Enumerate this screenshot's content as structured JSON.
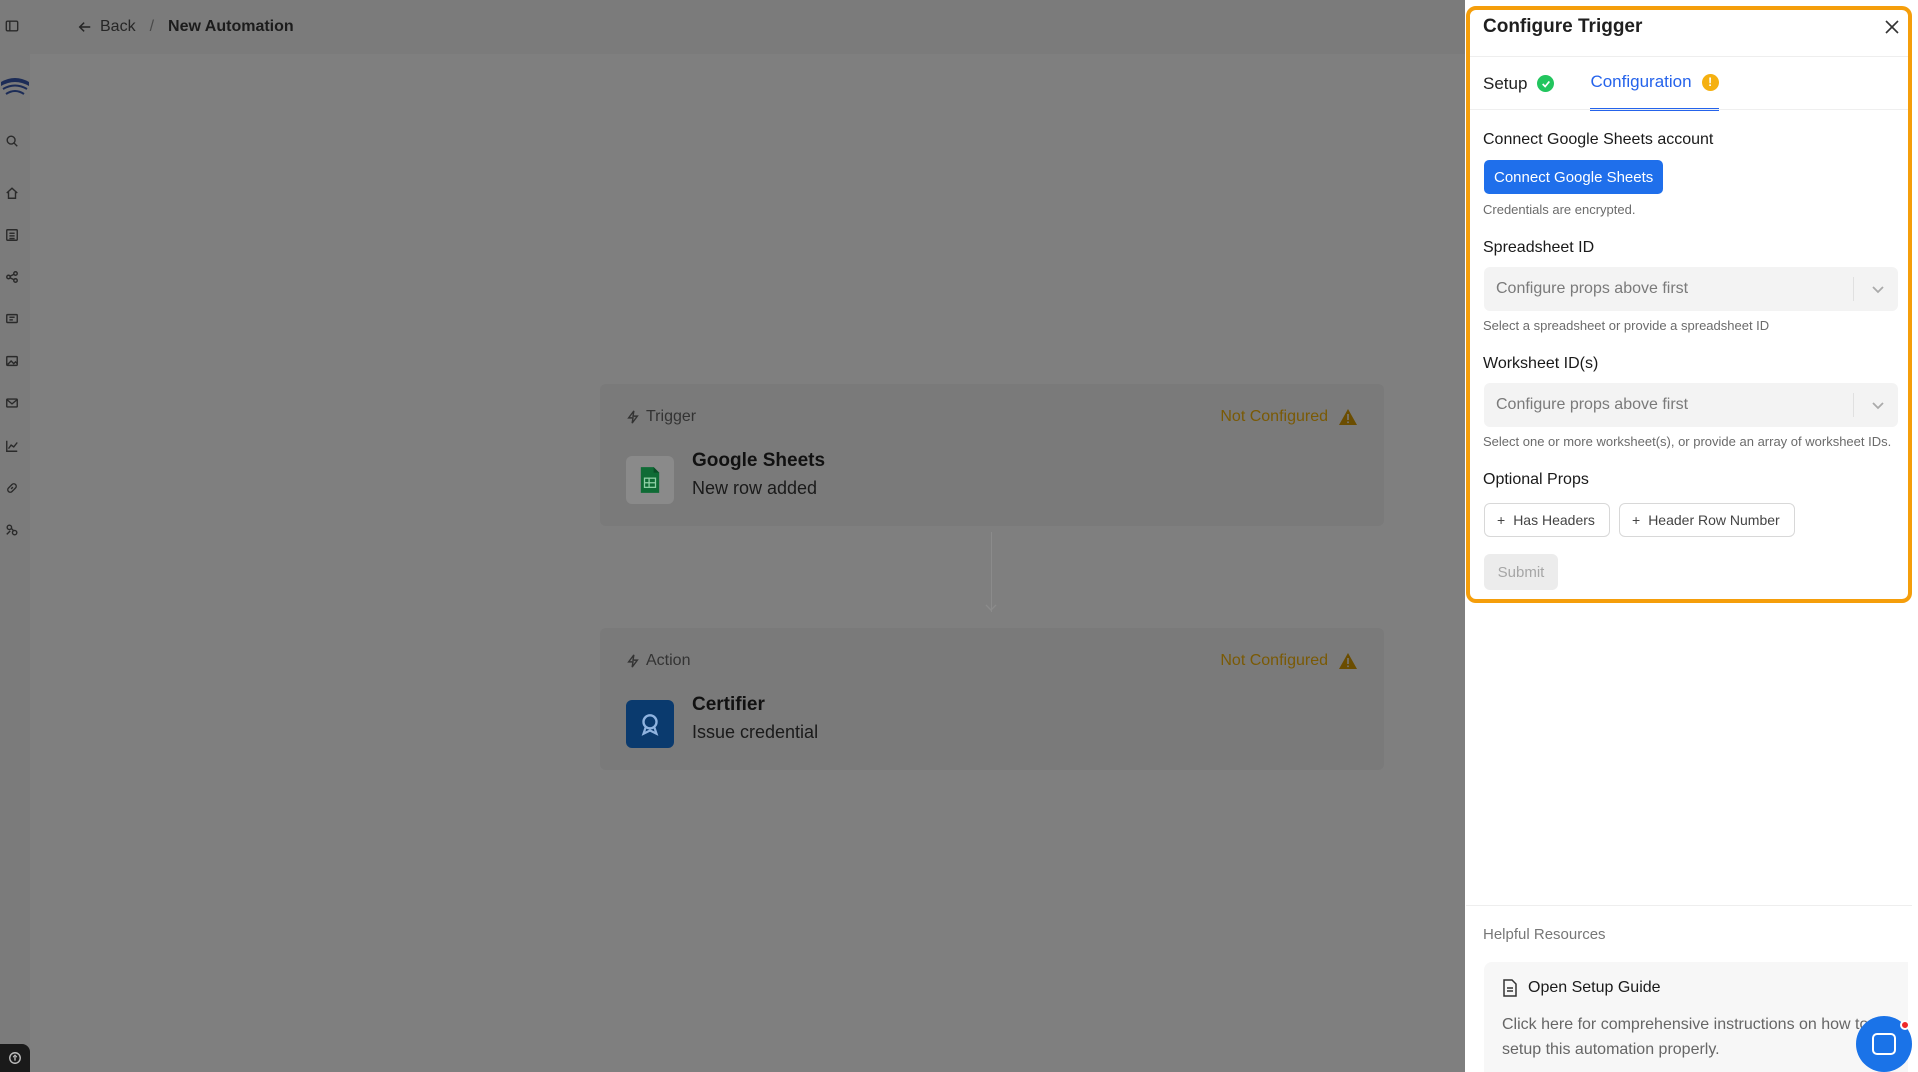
{
  "topbar": {
    "back_label": "Back",
    "breadcrumb_sep": "/",
    "title": "New Automation"
  },
  "rail": {
    "icons": [
      "sidebar-toggle-icon",
      "logo-icon",
      "search-icon",
      "home-icon",
      "list-icon",
      "workflow-icon",
      "messages-icon",
      "image-icon",
      "mail-icon",
      "chart-icon",
      "link-icon",
      "integrations-icon"
    ],
    "help_icon": "help-icon"
  },
  "canvas": {
    "trigger": {
      "kind": "Trigger",
      "status": "Not Configured",
      "app": "Google Sheets",
      "event": "New row added"
    },
    "action": {
      "kind": "Action",
      "status": "Not Configured",
      "app": "Certifier",
      "event": "Issue credential"
    }
  },
  "panel": {
    "title": "Configure Trigger",
    "tabs": [
      {
        "label": "Setup",
        "state": "complete"
      },
      {
        "label": "Configuration",
        "state": "warning"
      }
    ],
    "warn_mark": "!",
    "connect": {
      "label": "Connect Google Sheets account",
      "button": "Connect Google Sheets",
      "hint": "Credentials are encrypted."
    },
    "spreadsheet": {
      "label": "Spreadsheet ID",
      "value": "Configure props above first",
      "hint": "Select a spreadsheet or provide a spreadsheet ID"
    },
    "worksheet": {
      "label": "Worksheet ID(s)",
      "value": "Configure props above first",
      "hint": "Select one or more worksheet(s), or provide an array of worksheet IDs."
    },
    "optional": {
      "label": "Optional Props",
      "chips": [
        "Has Headers",
        "Header Row Number"
      ]
    },
    "submit": "Submit",
    "resources": {
      "title": "Helpful Resources",
      "link": "Open Setup Guide",
      "description": "Click here for comprehensive instructions on how to setup this automation properly."
    }
  },
  "colors": {
    "accent": "#2563eb",
    "success": "#22c55e",
    "warning": "#f5b010",
    "highlight": "#f59e0b"
  }
}
